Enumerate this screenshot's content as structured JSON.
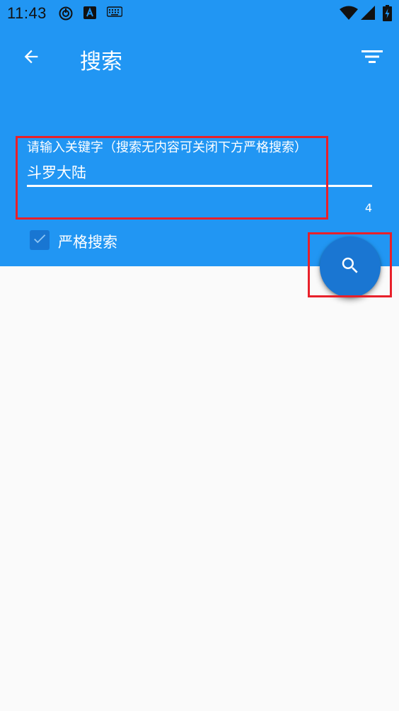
{
  "status_bar": {
    "time": "11:43",
    "icons_left": [
      "sync-icon",
      "text-a-icon",
      "keyboard-icon"
    ],
    "icons_right": [
      "wifi-icon",
      "signal-icon",
      "battery-charging-icon"
    ]
  },
  "toolbar": {
    "title": "搜索",
    "back_icon": "arrow-back-icon",
    "filter_icon": "filter-icon"
  },
  "search": {
    "label": "请输入关键字（搜索无内容可关闭下方严格搜索）",
    "value": "斗罗大陆",
    "counter": "4"
  },
  "strict_search": {
    "label": "严格搜索",
    "checked": true
  },
  "fab": {
    "icon": "search-icon"
  },
  "colors": {
    "primary": "#2196f3",
    "primary_dark": "#1976d2",
    "highlight": "#e8202a",
    "background": "#fafafa"
  }
}
